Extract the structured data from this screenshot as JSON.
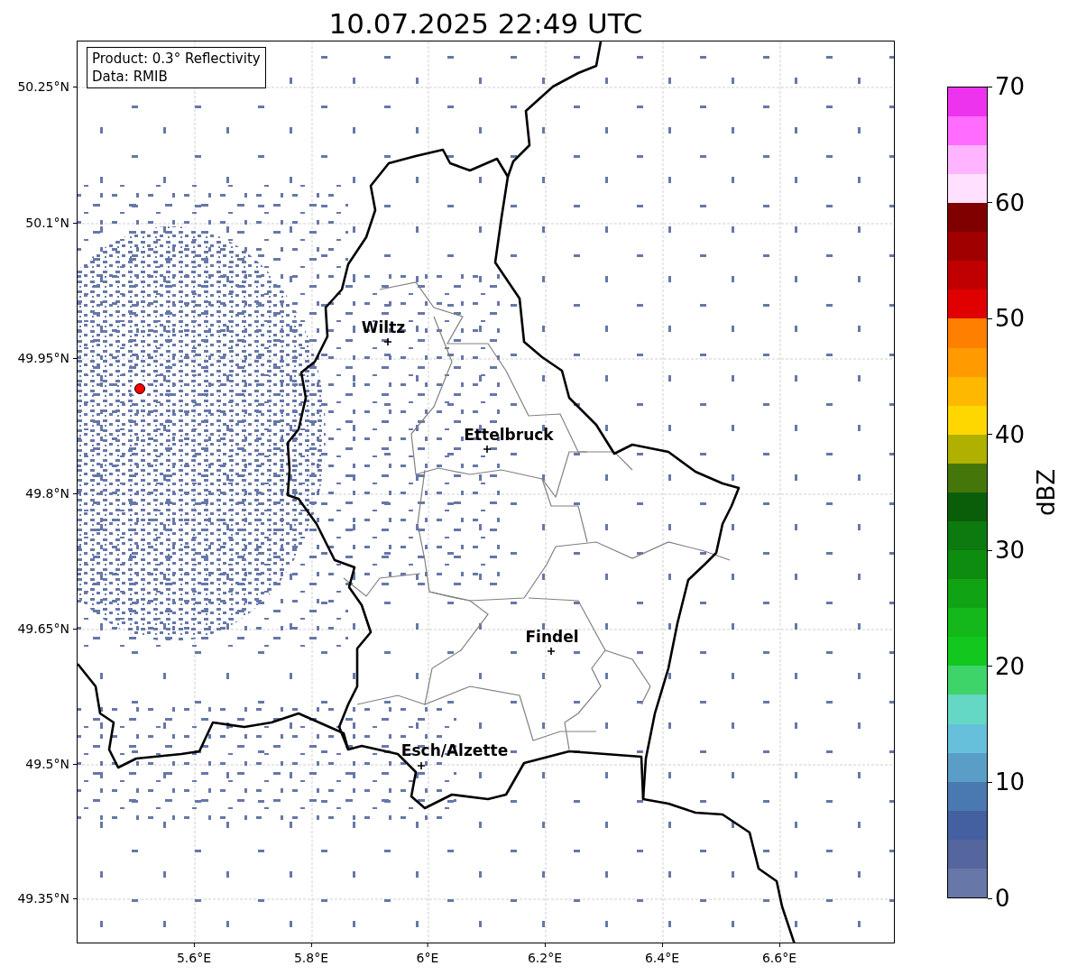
{
  "title": "10.07.2025 22:49 UTC",
  "map": {
    "info": [
      "Product: 0.3° Reflectivity",
      "Data: RMIB"
    ],
    "lat_ticks": [
      "50.25°N",
      "50.1°N",
      "49.95°N",
      "49.8°N",
      "49.65°N",
      "49.5°N",
      "49.35°N"
    ],
    "lon_ticks": [
      "5.6°E",
      "5.8°E",
      "6°E",
      "6.2°E",
      "6.4°E",
      "6.6°E"
    ],
    "places": [
      {
        "name": "Wiltz"
      },
      {
        "name": "Ettelbruck"
      },
      {
        "name": "Findel"
      },
      {
        "name": "Esch/Alzette"
      }
    ]
  },
  "colorbar": {
    "label": "dBZ",
    "ticks": [
      "70",
      "60",
      "50",
      "40",
      "30",
      "20",
      "10",
      "0"
    ],
    "segments": [
      {
        "color": "#6677a8"
      },
      {
        "color": "#55669e"
      },
      {
        "color": "#4460a0"
      },
      {
        "color": "#4a78b0"
      },
      {
        "color": "#5a9ec8"
      },
      {
        "color": "#66c0dc"
      },
      {
        "color": "#64d8c4"
      },
      {
        "color": "#3fd46a"
      },
      {
        "color": "#12c81e"
      },
      {
        "color": "#14b81a"
      },
      {
        "color": "#10a414"
      },
      {
        "color": "#0e8c10"
      },
      {
        "color": "#0c7a0e"
      },
      {
        "color": "#0a5e0a"
      },
      {
        "color": "#45760a"
      },
      {
        "color": "#b0b000"
      },
      {
        "color": "#ffd700"
      },
      {
        "color": "#ffb800"
      },
      {
        "color": "#ff9a00"
      },
      {
        "color": "#ff8000"
      },
      {
        "color": "#e00000"
      },
      {
        "color": "#c00000"
      },
      {
        "color": "#a00000"
      },
      {
        "color": "#800000"
      },
      {
        "color": "#ffe0ff"
      },
      {
        "color": "#ffb4ff"
      },
      {
        "color": "#ff6cff"
      },
      {
        "color": "#ee33ee"
      }
    ]
  }
}
